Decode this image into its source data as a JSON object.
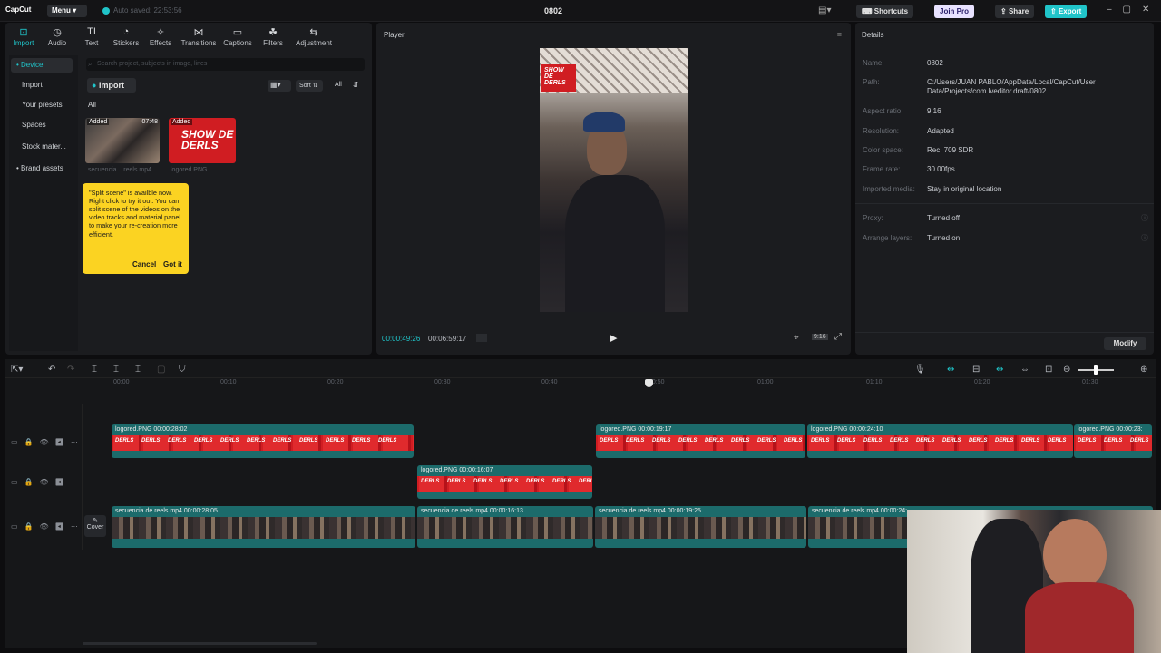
{
  "titlebar": {
    "logo": "CapCut",
    "menu": "Menu",
    "autosave": "Auto saved: 22:53:56",
    "project": "0802",
    "shortcuts": "Shortcuts",
    "join_pro": "Join Pro",
    "share": "Share",
    "export": "Export"
  },
  "toolbar": [
    {
      "label": "Import",
      "icon": "import-icon"
    },
    {
      "label": "Audio",
      "icon": "audio-icon"
    },
    {
      "label": "Text",
      "icon": "text-icon"
    },
    {
      "label": "Stickers",
      "icon": "stickers-icon"
    },
    {
      "label": "Effects",
      "icon": "effects-icon"
    },
    {
      "label": "Transitions",
      "icon": "transitions-icon"
    },
    {
      "label": "Captions",
      "icon": "captions-icon"
    },
    {
      "label": "Filters",
      "icon": "filters-icon"
    },
    {
      "label": "Adjustment",
      "icon": "adjustment-icon"
    }
  ],
  "sidebar": [
    "• Device",
    "Import",
    "Your presets",
    "Spaces",
    "Stock mater...",
    "• Brand assets"
  ],
  "media": {
    "search_placeholder": "Search project, subjects in image, lines",
    "import": "Import",
    "sort": "Sort",
    "all": "All",
    "filter_all": "All",
    "items": [
      {
        "badge": "Added",
        "duration": "07:48",
        "name": "secuencia ...reels.mp4"
      },
      {
        "badge": "Added",
        "duration": "",
        "name": "logored.PNG"
      }
    ],
    "tooltip": {
      "text": "\"Split scene\" is availble now. Right click to try it out. You can split scene of the videos on the video tracks and material panel to make your re-creation more efficient.",
      "cancel": "Cancel",
      "ok": "Got it"
    }
  },
  "player": {
    "title": "Player",
    "current": "00:00:49:26",
    "total": "00:06:59:17",
    "ratio": "9:16",
    "logo": "SHOW DE DERLS"
  },
  "details": {
    "title": "Details",
    "rows": [
      {
        "k": "Name:",
        "v": "0802"
      },
      {
        "k": "Path:",
        "v": "C:/Users/JUAN PABLO/AppData/Local/CapCut/User Data/Projects/com.lveditor.draft/0802"
      },
      {
        "k": "Aspect ratio:",
        "v": "9:16"
      },
      {
        "k": "Resolution:",
        "v": "Adapted"
      },
      {
        "k": "Color space:",
        "v": "Rec. 709 SDR"
      },
      {
        "k": "Frame rate:",
        "v": "30.00fps"
      },
      {
        "k": "Imported media:",
        "v": "Stay in original location"
      },
      {
        "k": "Proxy:",
        "v": "Turned off"
      },
      {
        "k": "Arrange layers:",
        "v": "Turned on"
      }
    ],
    "modify": "Modify"
  },
  "timeline": {
    "ruler": [
      "00:00",
      "00:10",
      "00:20",
      "00:30",
      "00:40",
      "00:50",
      "01:00",
      "01:10",
      "01:20",
      "01:30"
    ],
    "cover": "Cover",
    "clips": [
      {
        "track": 0,
        "label": "logored.PNG  00:00:28:02",
        "type": "img"
      },
      {
        "track": 0,
        "label": "logored.PNG  00:00:19:17",
        "type": "img"
      },
      {
        "track": 0,
        "label": "logored.PNG  00:00:24:10",
        "type": "img"
      },
      {
        "track": 0,
        "label": "logored.PNG  00:00:23:",
        "type": "img"
      },
      {
        "track": 1,
        "label": "logored.PNG  00:00:16:07",
        "type": "img"
      },
      {
        "track": 2,
        "label": "secuencia de reels.mp4   00:00:28:05",
        "type": "vid"
      },
      {
        "track": 2,
        "label": "secuencia de reels.mp4   00:00:16:13",
        "type": "vid"
      },
      {
        "track": 2,
        "label": "secuencia de reels.mp4   00:00:19:25",
        "type": "vid"
      },
      {
        "track": 2,
        "label": "secuencia de reels.mp4   00:00:24:",
        "type": "vid"
      }
    ]
  }
}
